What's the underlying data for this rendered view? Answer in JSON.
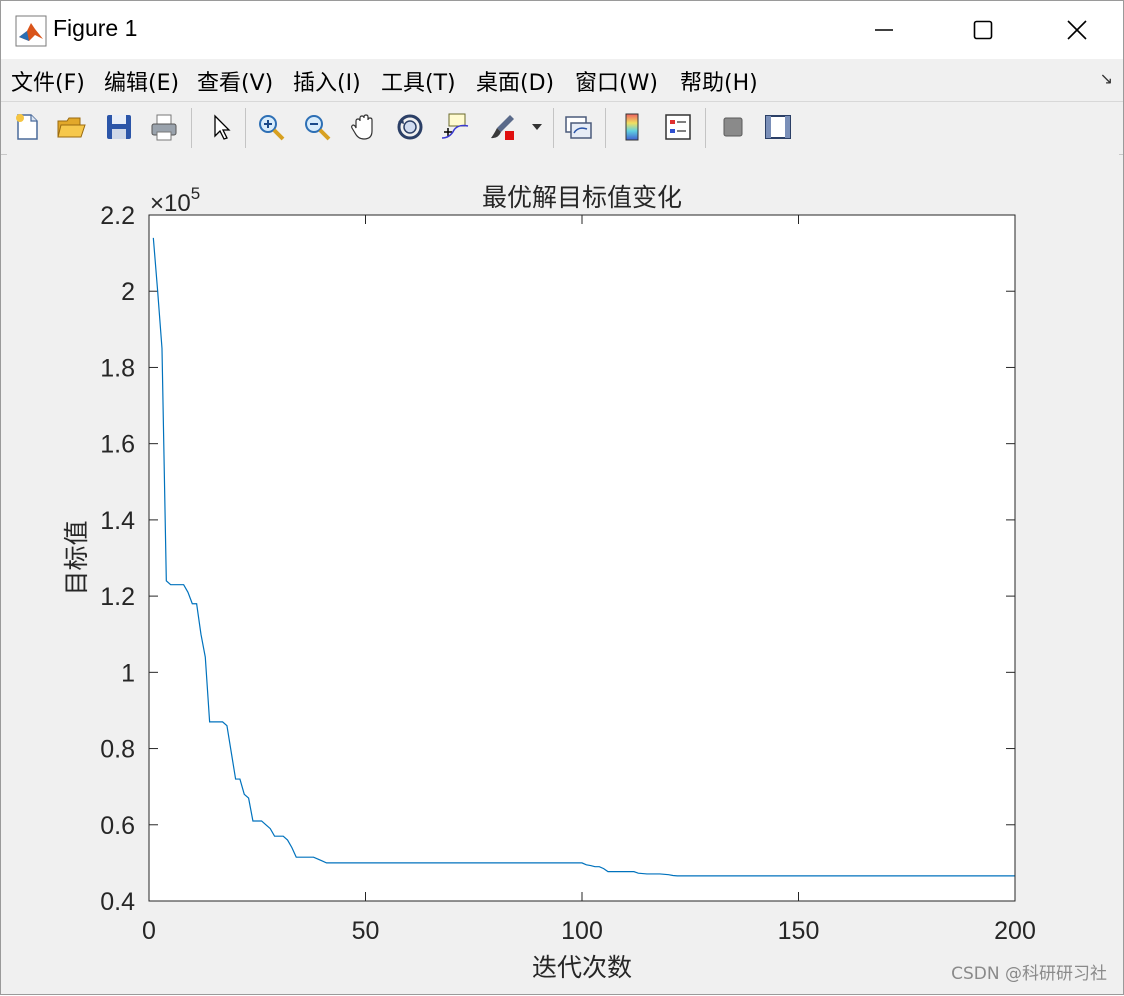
{
  "window": {
    "title": "Figure 1",
    "controls": [
      "minimize",
      "maximize",
      "close"
    ]
  },
  "menubar": {
    "items": [
      "文件(F)",
      "编辑(E)",
      "查看(V)",
      "插入(I)",
      "工具(T)",
      "桌面(D)",
      "窗口(W)",
      "帮助(H)"
    ],
    "overflow_icon": "dock-arrow-icon"
  },
  "toolbar": {
    "icons": [
      "new-figure-icon",
      "open-file-icon",
      "save-icon",
      "print-icon",
      "pointer-icon",
      "zoom-in-icon",
      "zoom-out-icon",
      "pan-hand-icon",
      "rotate-3d-icon",
      "data-cursor-icon",
      "brush-icon",
      "link-plot-icon",
      "colorbar-icon",
      "legend-icon",
      "hide-plot-tools-icon",
      "show-plot-tools-icon"
    ]
  },
  "chart_data": {
    "type": "line",
    "title": "最优解目标值变化",
    "xlabel": "迭代次数",
    "ylabel": "目标值",
    "exponent_label": "×10",
    "exponent_power": "5",
    "xlim": [
      0,
      200
    ],
    "ylim": [
      0.4,
      2.2
    ],
    "xticks": [
      0,
      50,
      100,
      150,
      200
    ],
    "xtick_labels": [
      "0",
      "50",
      "100",
      "150",
      "200"
    ],
    "yticks": [
      0.4,
      0.6,
      0.8,
      1.0,
      1.2,
      1.4,
      1.6,
      1.8,
      2.0,
      2.2
    ],
    "ytick_labels": [
      "0.4",
      "0.6",
      "0.8",
      "1",
      "1.2",
      "1.4",
      "1.6",
      "1.8",
      "2",
      "2.2"
    ],
    "grid": false,
    "line_color": "#0072bd",
    "x": [
      1,
      2,
      3,
      4,
      5,
      6,
      7,
      8,
      9,
      10,
      11,
      12,
      13,
      14,
      15,
      16,
      17,
      18,
      19,
      20,
      21,
      22,
      23,
      24,
      25,
      26,
      27,
      28,
      29,
      30,
      31,
      32,
      33,
      34,
      35,
      36,
      37,
      38,
      39,
      40,
      41,
      50,
      60,
      70,
      80,
      90,
      99,
      100,
      101,
      102,
      103,
      104,
      105,
      106,
      107,
      108,
      109,
      110,
      111,
      112,
      113,
      114,
      115,
      116,
      117,
      118,
      119,
      120,
      121,
      122,
      130,
      140,
      150,
      160,
      170,
      180,
      190,
      200
    ],
    "y": [
      2.14,
      2.0,
      1.85,
      1.24,
      1.23,
      1.23,
      1.23,
      1.23,
      1.21,
      1.18,
      1.18,
      1.1,
      1.04,
      0.87,
      0.87,
      0.87,
      0.87,
      0.86,
      0.79,
      0.72,
      0.72,
      0.68,
      0.67,
      0.61,
      0.61,
      0.61,
      0.6,
      0.59,
      0.57,
      0.57,
      0.57,
      0.56,
      0.54,
      0.515,
      0.515,
      0.515,
      0.515,
      0.515,
      0.51,
      0.505,
      0.5,
      0.5,
      0.5,
      0.5,
      0.5,
      0.5,
      0.5,
      0.5,
      0.495,
      0.493,
      0.49,
      0.49,
      0.485,
      0.477,
      0.477,
      0.477,
      0.477,
      0.477,
      0.477,
      0.477,
      0.473,
      0.472,
      0.471,
      0.471,
      0.471,
      0.471,
      0.47,
      0.469,
      0.467,
      0.466,
      0.466,
      0.466,
      0.466,
      0.466,
      0.466,
      0.466,
      0.466,
      0.466
    ]
  },
  "watermark": "CSDN @科研研习社"
}
